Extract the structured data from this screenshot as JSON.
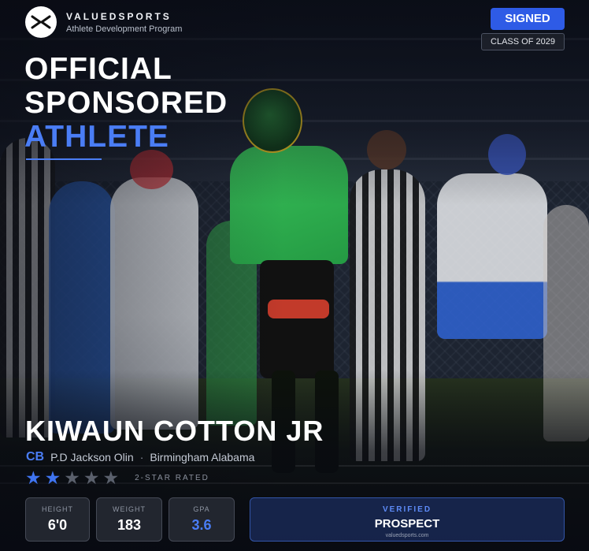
{
  "brand": {
    "name": "VALUEDSPORTS",
    "subtitle": "Athlete Development Program",
    "logo_icon": "crossed-arrows-icon"
  },
  "badges": {
    "signed": "SIGNED",
    "class": "CLASS OF 2029"
  },
  "headline": {
    "line1": "OFFICIAL",
    "line2": "SPONSORED",
    "line3": "ATHLETE"
  },
  "athlete": {
    "name": "KIWAUN COTTON JR",
    "position": "CB",
    "school": "P.D Jackson Olin",
    "separator": "·",
    "location": "Birmingham Alabama",
    "stars_filled": 2,
    "stars_total": 5,
    "rating_label": "2-STAR RATED"
  },
  "stats": [
    {
      "label": "HEIGHT",
      "value": "6'0"
    },
    {
      "label": "WEIGHT",
      "value": "183"
    },
    {
      "label": "GPA",
      "value": "3.6"
    }
  ],
  "verified": {
    "label": "VERIFIED",
    "value": "PROSPECT",
    "url": "valuedsports.com"
  },
  "colors": {
    "accent": "#4a7df5",
    "signed_bg": "#2e5be6",
    "jersey_green": "#2fa84a",
    "jersey_yellow": "#e8c320"
  }
}
